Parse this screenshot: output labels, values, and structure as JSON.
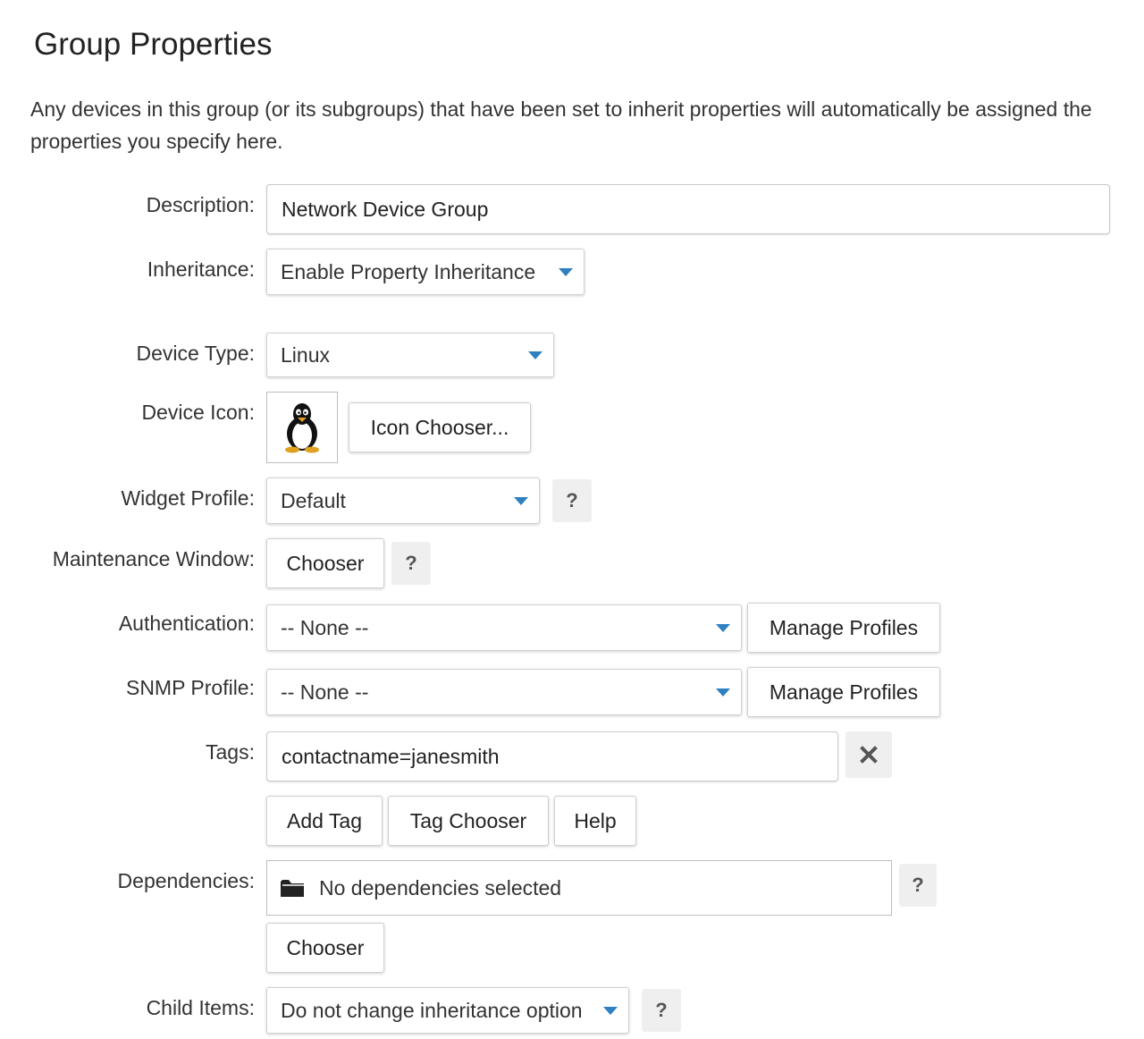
{
  "page": {
    "title": "Group Properties",
    "intro": "Any devices in this group (or its subgroups) that have been set to inherit properties will automatically be assigned the properties you specify here."
  },
  "form": {
    "description": {
      "label": "Description:",
      "value": "Network Device Group"
    },
    "inheritance": {
      "label": "Inheritance:",
      "value": "Enable Property Inheritance"
    },
    "device_type": {
      "label": "Device Type:",
      "value": "Linux"
    },
    "device_icon": {
      "label": "Device Icon:",
      "icon": "linux-penguin-icon",
      "button": "Icon Chooser..."
    },
    "widget_profile": {
      "label": "Widget Profile:",
      "value": "Default",
      "help": "?"
    },
    "maintenance_window": {
      "label": "Maintenance Window:",
      "button": "Chooser",
      "help": "?"
    },
    "authentication": {
      "label": "Authentication:",
      "value": "-- None --",
      "button": "Manage Profiles"
    },
    "snmp_profile": {
      "label": "SNMP Profile:",
      "value": "-- None --",
      "button": "Manage Profiles"
    },
    "tags": {
      "label": "Tags:",
      "value": "contactname=janesmith",
      "clear_icon": "close-icon",
      "add_button": "Add Tag",
      "chooser_button": "Tag Chooser",
      "help_button": "Help"
    },
    "dependencies": {
      "label": "Dependencies:",
      "icon": "folder-icon",
      "value": "No dependencies selected",
      "help": "?",
      "button": "Chooser"
    },
    "child_items": {
      "label": "Child Items:",
      "value": "Do not change inheritance option",
      "help": "?"
    }
  },
  "colors": {
    "caret": "#2f80c0",
    "help_bg": "#efefef",
    "border": "#c9c9c9"
  }
}
